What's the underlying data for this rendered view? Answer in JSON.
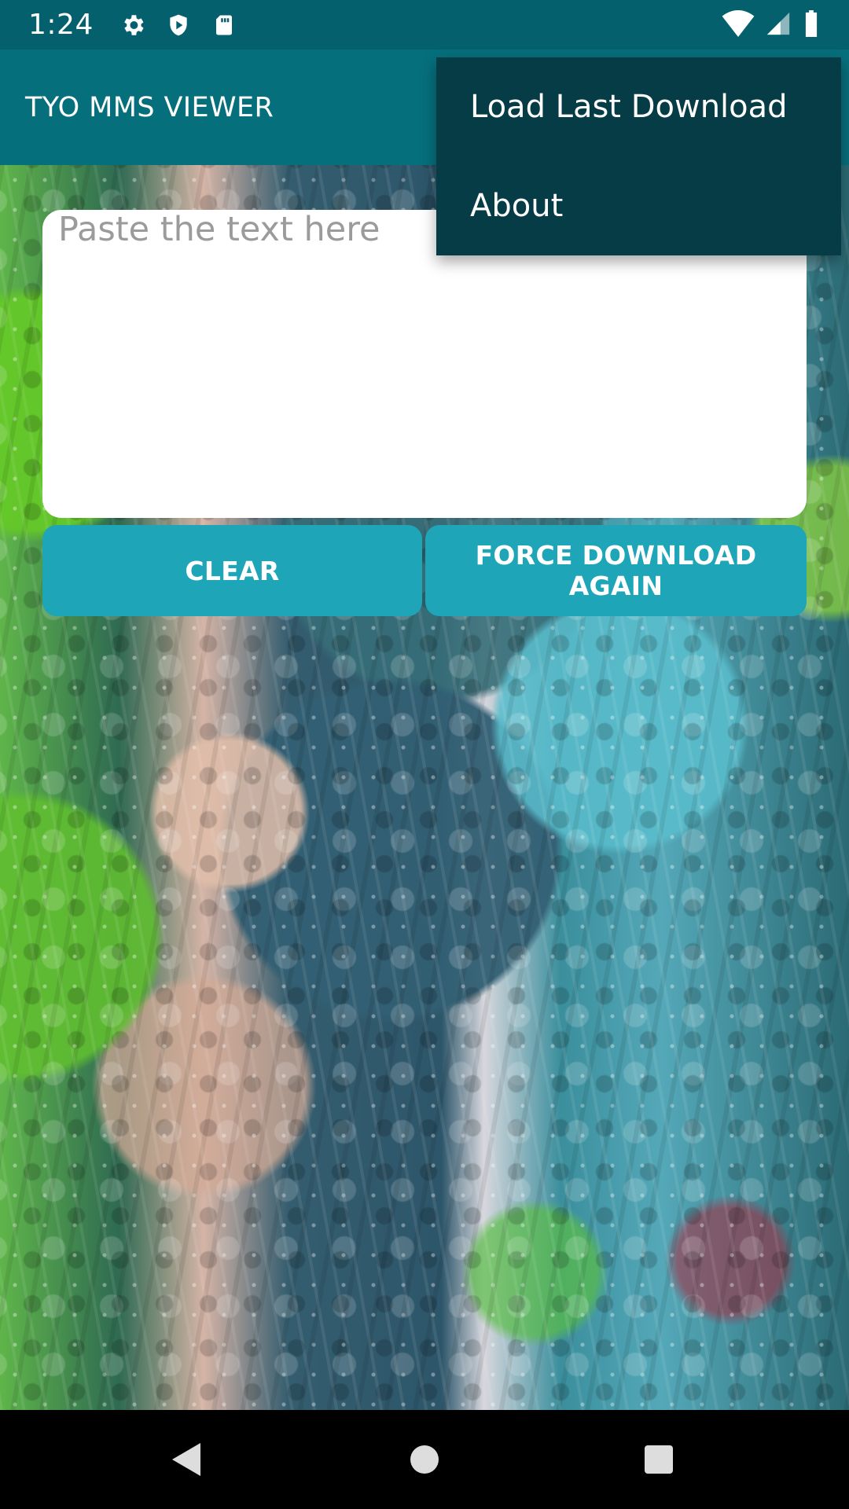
{
  "status_bar": {
    "time": "1:24",
    "icons_left": [
      "gear-icon",
      "shield-play-icon",
      "sd-card-icon"
    ],
    "icons_right": [
      "wifi-icon",
      "cellular-icon",
      "battery-icon"
    ]
  },
  "app": {
    "title": "TYO MMS VIEWER",
    "primary_color": "#066f7c",
    "button_color": "#1ea5b8",
    "menu_color": "#063c45"
  },
  "input": {
    "value": "",
    "placeholder": "Paste the text here"
  },
  "buttons": {
    "clear": "CLEAR",
    "force_download": "FORCE DOWNLOAD AGAIN"
  },
  "overflow_menu": {
    "items": [
      {
        "label": "Load Last Download"
      },
      {
        "label": "About"
      }
    ]
  },
  "nav_bar": {
    "icons": [
      "back-icon",
      "home-icon",
      "recents-icon"
    ]
  }
}
